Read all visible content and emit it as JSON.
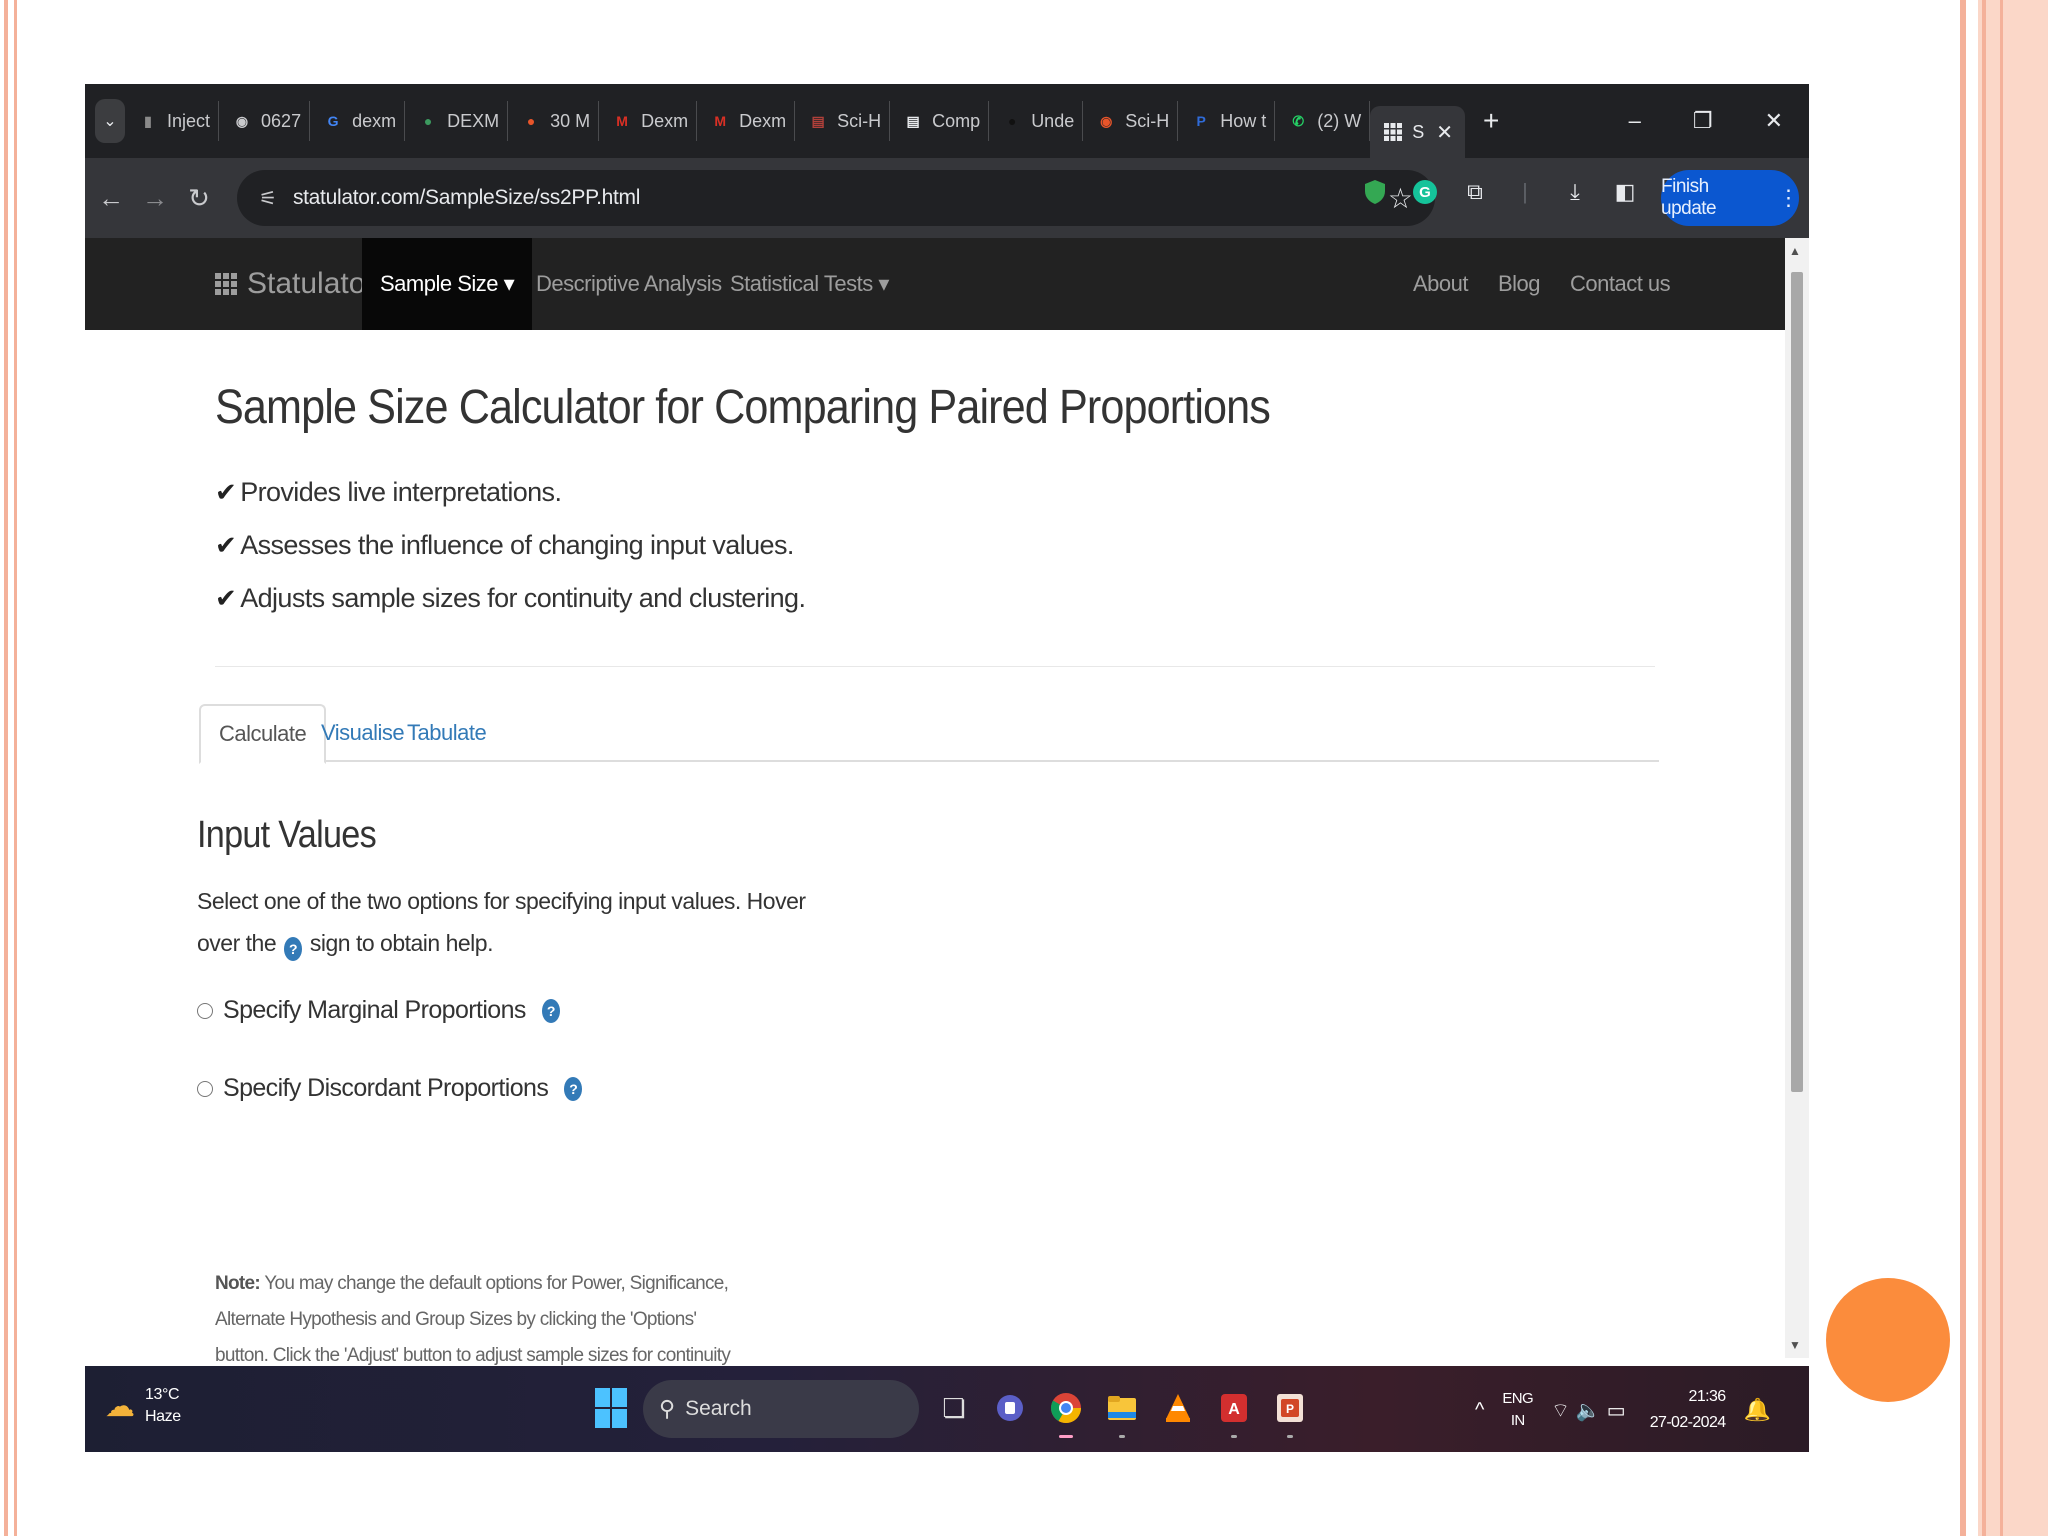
{
  "browser": {
    "tabs": [
      {
        "label": "Inject",
        "icon": "page-icon",
        "color": "#8a8a8a"
      },
      {
        "label": "0627",
        "icon": "globe-icon",
        "color": "#c9cacd"
      },
      {
        "label": "dexm",
        "icon": "google-icon",
        "color": "#4285f4"
      },
      {
        "label": "DEXM",
        "icon": "site-icon",
        "color": "#3c9a5f"
      },
      {
        "label": "30 M",
        "icon": "site-icon",
        "color": "#e8552a"
      },
      {
        "label": "Dexm",
        "icon": "m-icon",
        "color": "#d93025"
      },
      {
        "label": "Dexm",
        "icon": "m-icon",
        "color": "#d93025"
      },
      {
        "label": "Sci-H",
        "icon": "doc-icon",
        "color": "#b0403a"
      },
      {
        "label": "Comp",
        "icon": "doc-icon",
        "color": "#e8eaed"
      },
      {
        "label": "Unde",
        "icon": "site-icon",
        "color": "#111111"
      },
      {
        "label": "Sci-H",
        "icon": "eye-icon",
        "color": "#e8552a"
      },
      {
        "label": "How t",
        "icon": "p-icon",
        "color": "#2f6bd8"
      },
      {
        "label": "(2) W",
        "icon": "whatsapp-icon",
        "color": "#25d366"
      }
    ],
    "active_tab": {
      "label": "S",
      "icon": "grid-icon"
    },
    "url": "statulator.com/SampleSize/ss2PP.html",
    "finish_update": "Finish update"
  },
  "site": {
    "brand": "Statulator",
    "nav": {
      "sample_size": "Sample Size ▾",
      "descriptive": "Descriptive Analysis",
      "tests": "Statistical Tests ▾",
      "about": "About",
      "blog": "Blog",
      "contact": "Contact us"
    }
  },
  "main": {
    "title": "Sample Size Calculator for Comparing Paired Proportions",
    "features": [
      "Provides live interpretations.",
      "Assesses the influence of changing input values.",
      "Adjusts sample sizes for continuity and clustering."
    ],
    "tabs": {
      "calculate": "Calculate",
      "visualise": "Visualise",
      "tabulate": "Tabulate"
    },
    "input_title": "Input Values",
    "help_1": "Select one of the two options for specifying input values. Hover over the",
    "help_2": "sign to obtain help.",
    "option_marginal": "Specify Marginal Proportions",
    "option_discordant": "Specify Discordant Proportions",
    "note_label": "Note:",
    "note_text": "You may change the default options for Power, Significance, Alternate Hypothesis and Group Sizes by clicking the 'Options' button. Click the 'Adjust' button to adjust sample sizes for continuity (option applied by default), clustering and response rate."
  },
  "taskbar": {
    "temp": "13°C",
    "weather": "Haze",
    "search": "Search",
    "lang_1": "ENG",
    "lang_2": "IN",
    "time": "21:36",
    "date": "27-02-2024"
  },
  "colors": {
    "accent": "#337ab7",
    "nav_bg": "#222222",
    "slide_accent": "#fb8c3c"
  }
}
